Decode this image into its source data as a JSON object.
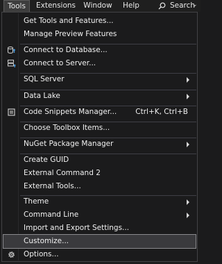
{
  "menubar": {
    "tools": "Tools",
    "extensions": "Extensions",
    "window": "Window",
    "help": "Help",
    "search": "Search",
    "search_chevron": "⌄"
  },
  "menu": {
    "get_tools": "Get Tools and Features...",
    "manage_preview": "Manage Preview Features",
    "connect_db": "Connect to Database...",
    "connect_server": "Connect to Server...",
    "sql_server": "SQL Server",
    "data_lake": "Data Lake",
    "code_snippets": "Code Snippets Manager...",
    "code_snippets_shortcut": "Ctrl+K, Ctrl+B",
    "choose_toolbox": "Choose Toolbox Items...",
    "nuget": "NuGet Package Manager",
    "create_guid": "Create GUID",
    "external_cmd2": "External Command 2",
    "external_tools": "External Tools...",
    "theme": "Theme",
    "command_line": "Command Line",
    "import_export": "Import and Export Settings...",
    "customize": "Customize...",
    "options": "Options..."
  },
  "colors": {
    "background": "#1b1b1c",
    "highlight": "#3a3a3d",
    "text": "#f1f1f1",
    "icon_accent": "#4aa0e6"
  }
}
